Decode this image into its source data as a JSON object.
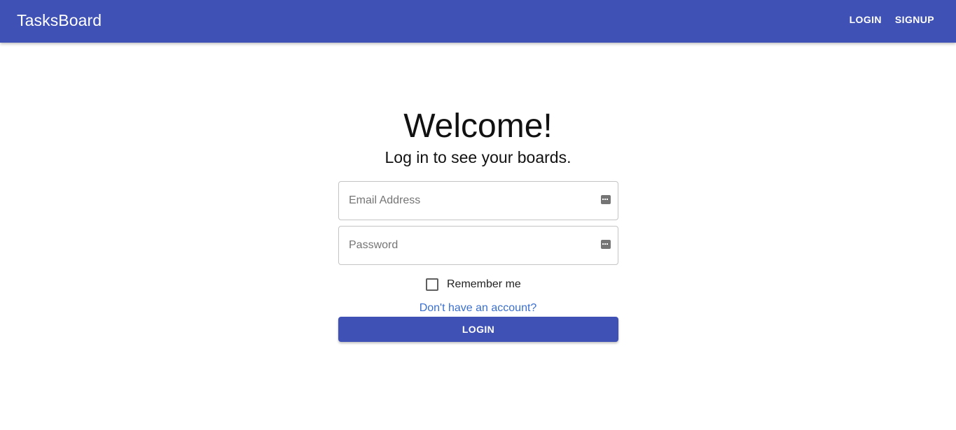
{
  "header": {
    "brand": "TasksBoard",
    "nav": {
      "login_label": "LOGIN",
      "signup_label": "SIGNUP"
    },
    "color": "#3f51b5"
  },
  "form": {
    "title": "Welcome!",
    "subtitle": "Log in to see your boards.",
    "email": {
      "placeholder": "Email Address",
      "value": "",
      "icon": "autofill-key-icon"
    },
    "password": {
      "placeholder": "Password",
      "value": "",
      "icon": "autofill-key-icon"
    },
    "remember": {
      "label": "Remember me",
      "checked": false
    },
    "signup_link": "Don't have an account?",
    "submit_label": "LOGIN",
    "link_color": "#3a6fcf"
  }
}
